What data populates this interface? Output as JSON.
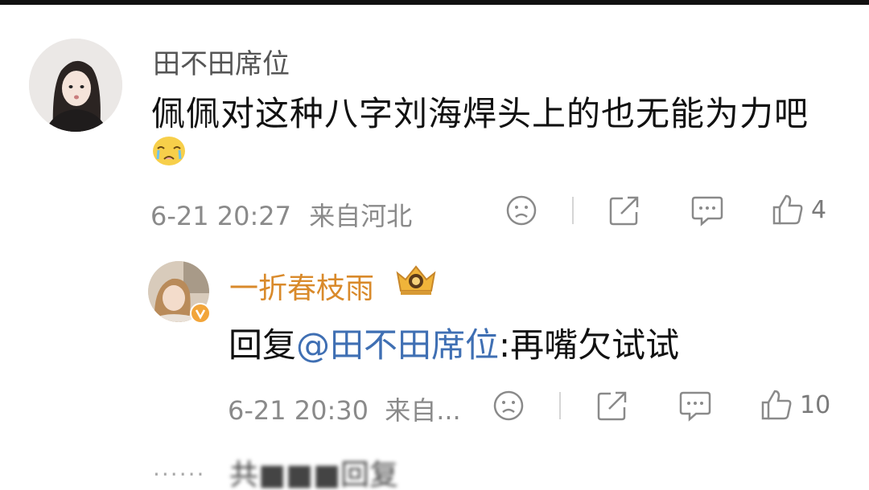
{
  "comment": {
    "username": "田不田席位",
    "text": "佩佩对这种八字刘海焊头上的也无能为力吧",
    "emoji": "crying-face-emoji",
    "time": "6-21 20:27",
    "location": "来自河北",
    "like_count": "4"
  },
  "reply": {
    "username": "一折春枝雨",
    "badge": "crown-badge-icon",
    "prefix": "回复",
    "mention": "@田不田席位",
    "text": ":再嘴欠试试",
    "time": "6-21 20:30",
    "location": "来自...",
    "like_count": "10"
  },
  "more_replies": {
    "dots": "......",
    "text": "共■■■回复"
  },
  "colors": {
    "username_gold": "#d98a2b",
    "mention_blue": "#3f6fb3",
    "meta_gray": "#8a8a8a"
  },
  "icons": [
    "sad-face-icon",
    "share-icon",
    "comment-icon",
    "thumbs-up-icon",
    "verified-v-icon"
  ]
}
